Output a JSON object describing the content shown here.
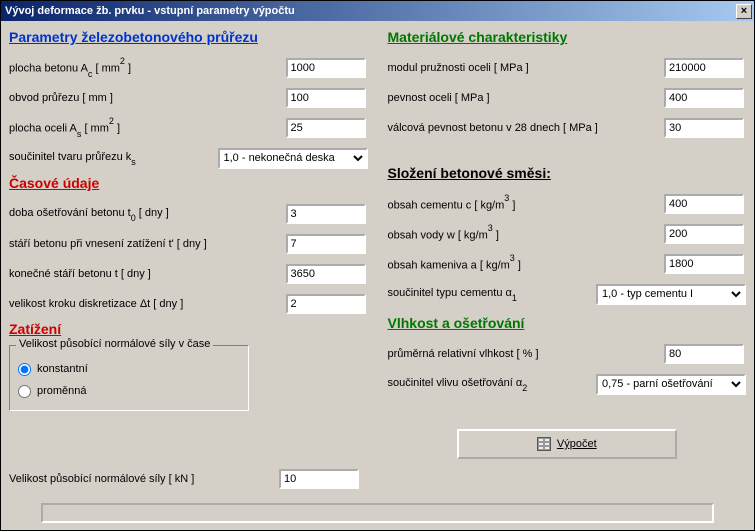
{
  "title": "Vývoj deformace žb. prvku - vstupní parametry výpočtu",
  "left": {
    "hParams": "Parametry železobetonového průřezu",
    "areaConc": "plocha betonu A",
    "areaConcSub": "c",
    "areaConcUnit": " [ mm",
    "areaConcSup": "2",
    "areaConcEnd": " ]",
    "areaConcVal": "1000",
    "perim": "obvod průřezu [ mm ]",
    "perimVal": "100",
    "areaSteel": "plocha oceli A",
    "areaSteelSub": "s",
    "areaSteelUnit": " [ mm",
    "areaSteelSup": "2",
    "areaSteelEnd": " ]",
    "areaSteelVal": "25",
    "shapeCoef": "součinitel tvaru průřezu k",
    "shapeCoefSub": "s",
    "shapeSelect": "1,0 - nekonečná deska",
    "hTime": "Časové údaje",
    "cureTime": "doba ošetřování betonu t",
    "cureTimeSub": "0",
    "cureTimeUnit": " [ dny ]",
    "cureTimeVal": "3",
    "ageLoad": "stáří betonu při vnesení zatížení t'  [ dny ]",
    "ageLoadVal": "7",
    "ageFinal": "konečné stáří betonu t [ dny ]",
    "ageFinalVal": "3650",
    "stepSize": "velikost kroku diskretizace Δt [ dny ]",
    "stepSizeVal": "2",
    "hLoad": "Zatížení",
    "groupLegend": "Velikost působící normálové síly v čase",
    "rConst": "konstantní",
    "rVar": "proměnná",
    "forceLabel": "Velikost působící normálové síly  [ kN ]",
    "forceVal": "10"
  },
  "right": {
    "hMat": "Materiálové charakteristiky",
    "modSteel": "modul pružnosti oceli [ MPa ]",
    "modSteelVal": "210000",
    "strSteel": "pevnost oceli [ MPa ]",
    "strSteelVal": "400",
    "strConc": "válcová pevnost betonu v 28 dnech [ MPa ]",
    "strConcVal": "30",
    "hMix": "Složení betonové směsi:",
    "cement": "obsah cementu c [ kg/m",
    "cementSup": "3",
    "cementEnd": " ]",
    "cementVal": "400",
    "water": "obsah vody w [ kg/m",
    "waterSup": "3",
    "waterEnd": " ]",
    "waterVal": "200",
    "agg": "obsah kameniva a [ kg/m",
    "aggSup": "3",
    "aggEnd": " ]",
    "aggVal": "1800",
    "cemType": "součinitel typu cementu α",
    "cemTypeSub": "1",
    "cemTypeSelect": "1,0 - typ cementu I",
    "hHumid": "Vlhkost a ošetřování",
    "relHumid": "průměrná relativní vlhkost [ % ]",
    "relHumidVal": "80",
    "careCoef": "součinitel vlivu ošetřování  α",
    "careCoefSub": "2",
    "careSelect": "0,75 - parní ošetřování",
    "calcBtn": "Výpočet"
  }
}
